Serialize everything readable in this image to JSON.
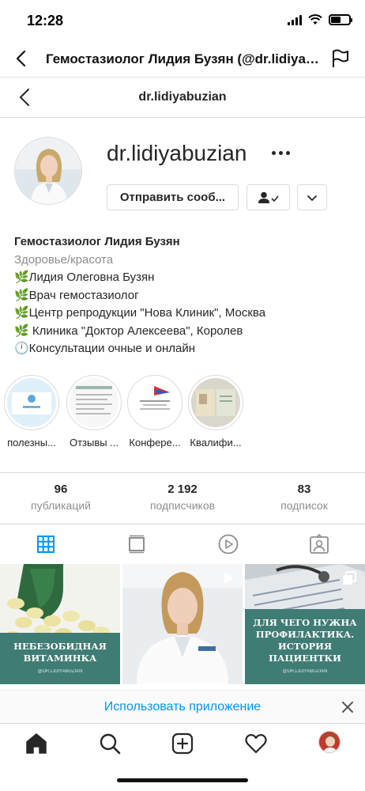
{
  "status_bar": {
    "time": "12:28"
  },
  "browser": {
    "title": "Гемостазиолог Лидия Бузян (@dr.lidiyabuzian)"
  },
  "ig_header": {
    "username": "dr.lidiyabuzian"
  },
  "profile": {
    "username": "dr.lidiyabuzian",
    "message_button": "Отправить сооб...",
    "bio": {
      "name": "Гемостазиолог Лидия Бузян",
      "category": "Здоровье/красота",
      "lines": [
        "🌿Лидия Олеговна Бузян",
        "🌿Врач гемостазиолог",
        "🌿Центр репродукции \"Нова Клиник\", Москва",
        "🌿 Клиника \"Доктор Алексеева\", Королев",
        "🕛Консультации очные и онлайн"
      ]
    }
  },
  "highlights": [
    {
      "label": "полезны..."
    },
    {
      "label": "Отзывы ..."
    },
    {
      "label": "Конфере..."
    },
    {
      "label": "Квалифи..."
    }
  ],
  "stats": [
    {
      "count": "96",
      "label": "публикаций"
    },
    {
      "count": "2 192",
      "label": "подписчиков"
    },
    {
      "count": "83",
      "label": "подписок"
    }
  ],
  "posts": [
    {
      "caption": "НЕБЕЗОБИДНАЯ ВИТАМИНКА",
      "handle": "@DR.LIDIYABUZIAN"
    },
    {
      "caption": ""
    },
    {
      "caption": "ДЛЯ ЧЕГО НУЖНА ПРОФИЛАКТИКА. ИСТОРИЯ ПАЦИЕНТКИ",
      "handle": "@DR.LIDIYABUZIAN"
    }
  ],
  "banner": {
    "text": "Использовать приложение"
  },
  "colors": {
    "link_blue": "#0095f6",
    "post_teal": "#3f7c74",
    "border": "#dbdbdb"
  }
}
